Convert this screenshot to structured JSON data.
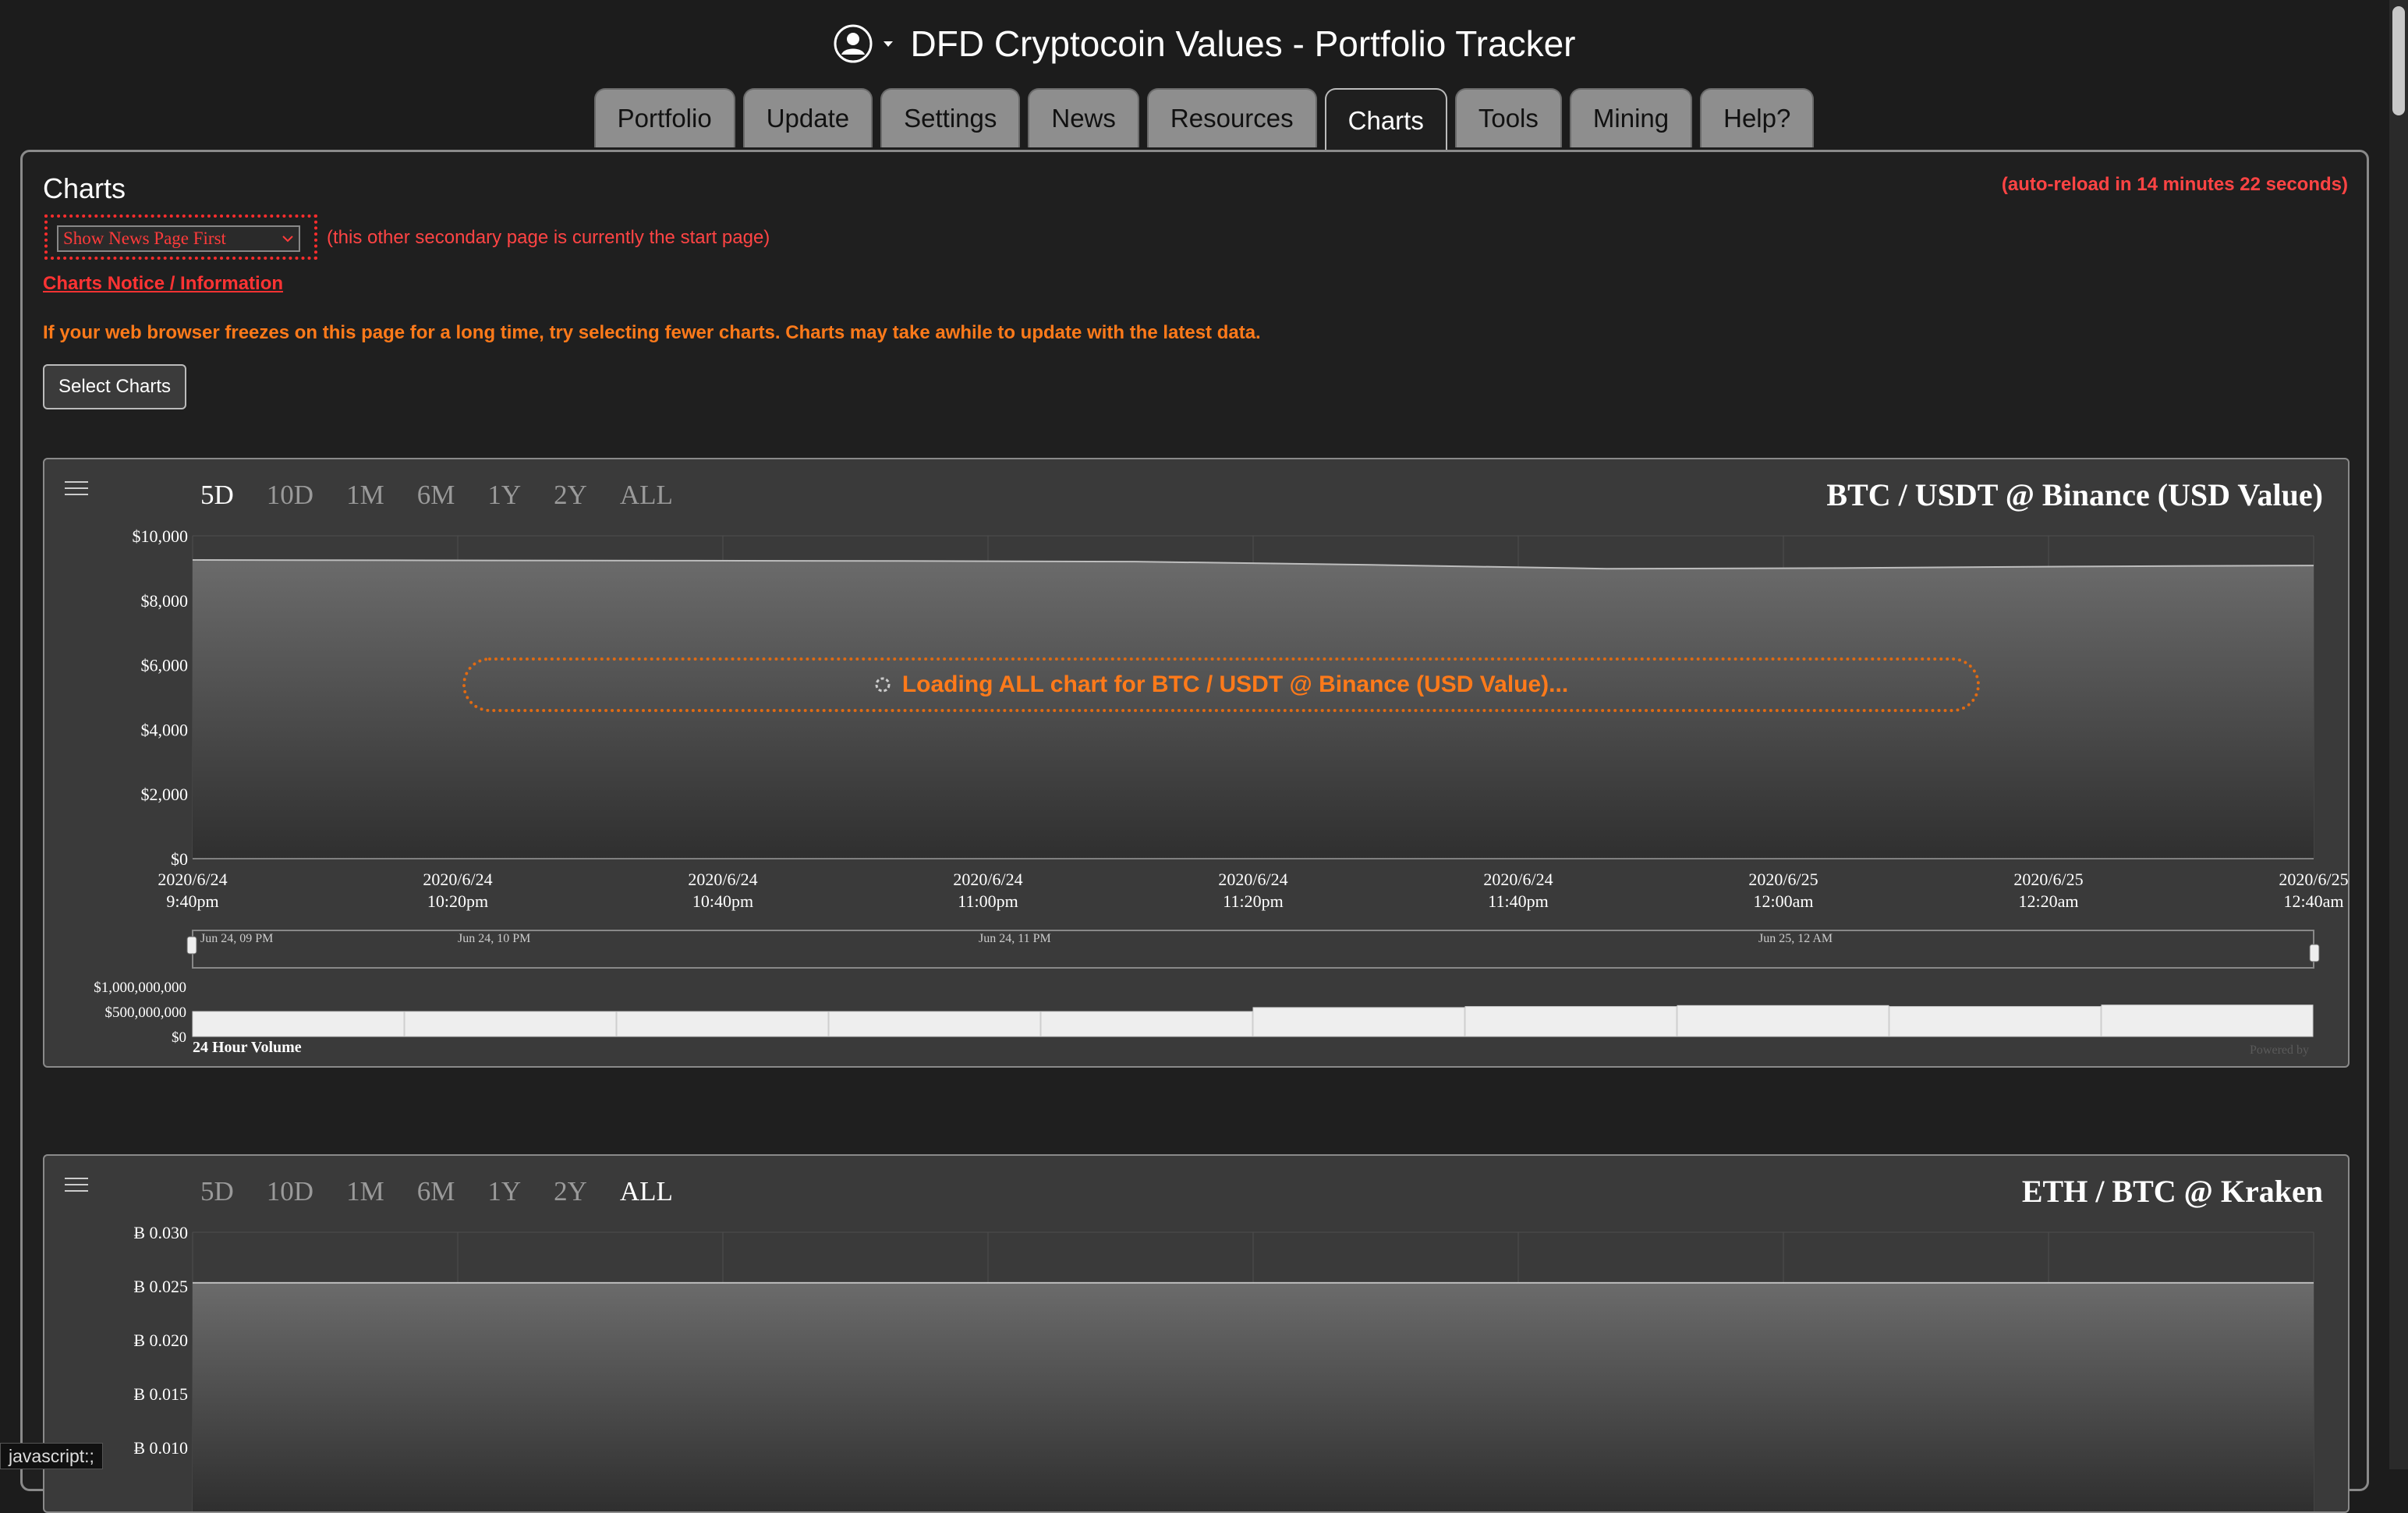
{
  "header": {
    "title": "DFD Cryptocoin Values - Portfolio Tracker",
    "user_icon": "user-circle-icon"
  },
  "tabs": [
    {
      "label": "Portfolio"
    },
    {
      "label": "Update"
    },
    {
      "label": "Settings"
    },
    {
      "label": "News"
    },
    {
      "label": "Resources"
    },
    {
      "label": "Charts",
      "active": true
    },
    {
      "label": "Tools"
    },
    {
      "label": "Mining"
    },
    {
      "label": "Help?"
    }
  ],
  "main": {
    "section_title": "Charts",
    "auto_reload": "(auto-reload in 14 minutes 22 seconds)",
    "start_page_select": "Show News Page First",
    "start_page_note": "(this other secondary page is currently the start page)",
    "notice_link": "Charts Notice / Information",
    "warning": "If your web browser freezes on this page for a long time, try selecting fewer charts. Charts may take awhile to update with the latest data.",
    "select_charts_button": "Select Charts"
  },
  "charts": [
    {
      "title": "BTC / USDT @ Binance (USD Value)",
      "ranges": [
        "5D",
        "10D",
        "1M",
        "6M",
        "1Y",
        "2Y",
        "ALL"
      ],
      "selected_range": "5D",
      "loading_text": "Loading ALL chart for BTC / USDT @ Binance (USD Value)...",
      "y_ticks": [
        "$10,000",
        "$8,000",
        "$6,000",
        "$4,000",
        "$2,000",
        "$0"
      ],
      "x_ticks": [
        [
          "2020/6/24",
          "9:40pm"
        ],
        [
          "2020/6/24",
          "10:20pm"
        ],
        [
          "2020/6/24",
          "10:40pm"
        ],
        [
          "2020/6/24",
          "11:00pm"
        ],
        [
          "2020/6/24",
          "11:20pm"
        ],
        [
          "2020/6/24",
          "11:40pm"
        ],
        [
          "2020/6/25",
          "12:00am"
        ],
        [
          "2020/6/25",
          "12:20am"
        ],
        [
          "2020/6/25",
          "12:40am"
        ]
      ],
      "navigator_labels": [
        "Jun 24, 09 PM",
        "Jun 24, 10 PM",
        "Jun 24, 11 PM",
        "Jun 25, 12 AM"
      ],
      "volume_ticks": [
        "$1,000,000,000",
        "$500,000,000",
        "$0"
      ],
      "volume_label": "24 Hour Volume",
      "powered_by": "Powered by"
    },
    {
      "title": "ETH / BTC @ Kraken",
      "ranges": [
        "5D",
        "10D",
        "1M",
        "6M",
        "1Y",
        "2Y",
        "ALL"
      ],
      "selected_range": "ALL",
      "y_ticks": [
        "Ƀ 0.030",
        "Ƀ 0.025",
        "Ƀ 0.020",
        "Ƀ 0.015",
        "Ƀ 0.010"
      ]
    }
  ],
  "chart_data": [
    {
      "type": "area",
      "title": "BTC / USDT @ Binance (USD Value)",
      "x": [
        "2020/6/24 9:40pm",
        "2020/6/24 10:00pm",
        "2020/6/24 10:20pm",
        "2020/6/24 10:40pm",
        "2020/6/24 11:00pm",
        "2020/6/24 11:20pm",
        "2020/6/24 11:40pm",
        "2020/6/25 12:00am",
        "2020/6/25 12:20am",
        "2020/6/25 12:40am"
      ],
      "series": [
        {
          "values": [
            9250,
            9240,
            9230,
            9220,
            9200,
            9100,
            8980,
            9000,
            9050,
            9080
          ]
        }
      ],
      "ylim": [
        0,
        10000
      ],
      "volume": {
        "label": "24 Hour Volume",
        "values": [
          500000000,
          500000000,
          500000000,
          500000000,
          500000000,
          580000000,
          600000000,
          620000000,
          600000000,
          630000000
        ],
        "ylim": [
          0,
          1000000000
        ]
      }
    },
    {
      "type": "area",
      "title": "ETH / BTC @ Kraken",
      "series": [
        {
          "values": [
            0.0253,
            0.0253,
            0.0253,
            0.0253,
            0.0253,
            0.0253,
            0.0253,
            0.0253,
            0.0253
          ]
        }
      ],
      "ylim": [
        0.01,
        0.03
      ]
    }
  ],
  "status_bar": "javascript:;",
  "colors": {
    "accent_red": "#ff3333",
    "warning_orange": "#ff7a1a",
    "card_bg": "#3a3a3a"
  }
}
